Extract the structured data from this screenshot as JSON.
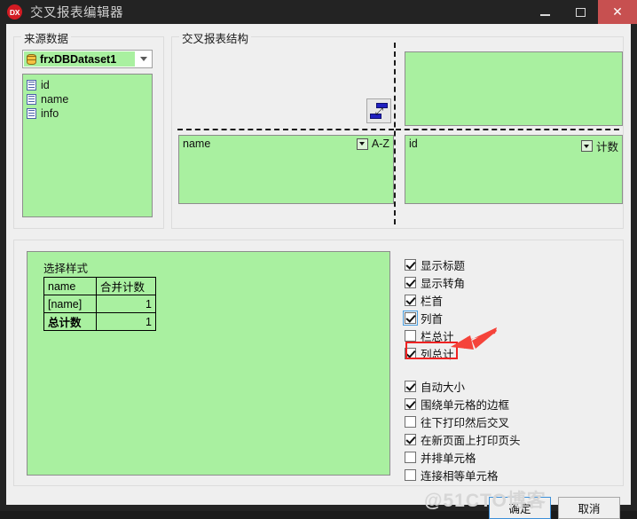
{
  "window": {
    "logo": "DX",
    "title": "交叉报表编辑器",
    "buttons": {
      "minimize": "minimize-icon",
      "maximize": "maximize-icon",
      "close": "✕"
    }
  },
  "source_panel": {
    "caption": "来源数据",
    "dataset_combo": {
      "value": "frxDBDataset1",
      "icon": "database-icon"
    },
    "fields": [
      {
        "label": "id",
        "icon": "field-icon"
      },
      {
        "label": "name",
        "icon": "field-icon"
      },
      {
        "label": "info",
        "icon": "field-icon"
      }
    ]
  },
  "structure_panel": {
    "caption": "交叉报表结构",
    "swap_button": "swap-icon",
    "zones": {
      "column_header": {
        "label": "",
        "right_label": ""
      },
      "row_header": {
        "label": "name",
        "right_label": "A-Z"
      },
      "data": {
        "label": "id",
        "right_label": "计数"
      }
    }
  },
  "style_panel": {
    "title": "选择样式",
    "table": {
      "rows": [
        {
          "c1": "name",
          "c2": "合并计数",
          "bold": false
        },
        {
          "c1": "[name]",
          "c2": "1",
          "bold": false
        },
        {
          "c1": "总计数",
          "c2": "1",
          "bold": true
        }
      ]
    }
  },
  "options_group_a": [
    {
      "label": "显示标题",
      "checked": true,
      "focused": false
    },
    {
      "label": "显示转角",
      "checked": true,
      "focused": false
    },
    {
      "label": "栏首",
      "checked": true,
      "focused": false
    },
    {
      "label": "列首",
      "checked": true,
      "focused": true
    },
    {
      "label": "栏总计",
      "checked": false,
      "focused": false
    },
    {
      "label": "列总计",
      "checked": true,
      "focused": false
    }
  ],
  "options_group_b": [
    {
      "label": "自动大小",
      "checked": true
    },
    {
      "label": "围绕单元格的边框",
      "checked": true
    },
    {
      "label": "往下打印然后交叉",
      "checked": false
    },
    {
      "label": "在新页面上打印页头",
      "checked": true
    },
    {
      "label": "并排单元格",
      "checked": false
    },
    {
      "label": "连接相等单元格",
      "checked": false
    }
  ],
  "footer": {
    "ok": "确定",
    "cancel": "取消"
  },
  "watermark": "@51CTO博客",
  "colors": {
    "titlebar": "#232323",
    "close_button": "#c75050",
    "green_fill": "#a9f0a0",
    "dialog_bg": "#efefef",
    "annotation_red": "#ee2222",
    "focus_blue": "#3c8fd8"
  }
}
